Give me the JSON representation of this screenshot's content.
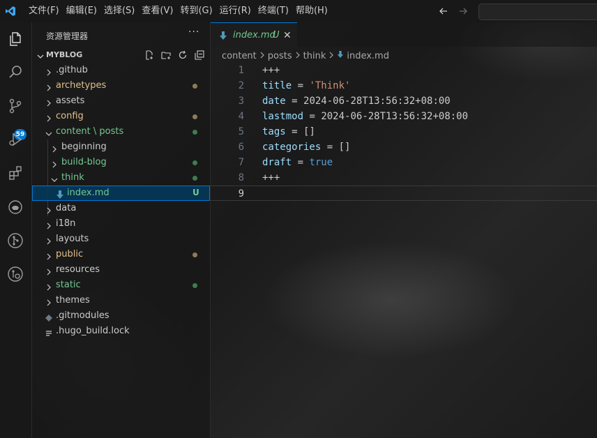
{
  "menu": [
    "文件(F)",
    "编辑(E)",
    "选择(S)",
    "查看(V)",
    "转到(G)",
    "运行(R)",
    "终端(T)",
    "帮助(H)"
  ],
  "activity": {
    "source_control_badge": "59"
  },
  "explorer": {
    "title": "资源管理器",
    "more": "···",
    "section": "MYBLOG",
    "items": [
      {
        "label": ".github",
        "color": "#cccccc"
      },
      {
        "label": "archetypes",
        "color": "#e2c08d",
        "dot": "#8f7b57"
      },
      {
        "label": "assets",
        "color": "#cccccc"
      },
      {
        "label": "config",
        "color": "#e2c08d",
        "dot": "#8f7b57"
      },
      {
        "label": "content \\ posts",
        "color": "#73c991",
        "dot": "#3f7d4d"
      },
      {
        "label": "beginning",
        "color": "#cccccc"
      },
      {
        "label": "build-blog",
        "color": "#73c991",
        "dot": "#3f7d4d"
      },
      {
        "label": "think",
        "color": "#73c991",
        "dot": "#3f7d4d"
      },
      {
        "label": "index.md",
        "color": "#73c991",
        "status": "U"
      },
      {
        "label": "data",
        "color": "#cccccc"
      },
      {
        "label": "i18n",
        "color": "#cccccc"
      },
      {
        "label": "layouts",
        "color": "#cccccc"
      },
      {
        "label": "public",
        "color": "#e2c08d",
        "dot": "#8f7b57"
      },
      {
        "label": "resources",
        "color": "#cccccc"
      },
      {
        "label": "static",
        "color": "#73c991",
        "dot": "#3f7d4d"
      },
      {
        "label": "themes",
        "color": "#cccccc"
      },
      {
        "label": ".gitmodules",
        "color": "#cccccc"
      },
      {
        "label": ".hugo_build.lock",
        "color": "#cccccc"
      }
    ]
  },
  "tab": {
    "name": "index.md",
    "status": "U",
    "close": "✕"
  },
  "breadcrumbs": [
    "content",
    "posts",
    "think",
    "index.md"
  ],
  "code_lines": [
    {
      "num": "1",
      "text": "+++"
    },
    {
      "num": "2",
      "key": "title",
      "eq": " = ",
      "value": "'Think'",
      "vtype": "str"
    },
    {
      "num": "3",
      "key": "date",
      "eq": " = ",
      "value": "2024-06-28T13:56:32+08:00",
      "vtype": "plain"
    },
    {
      "num": "4",
      "key": "lastmod",
      "eq": " = ",
      "value": "2024-06-28T13:56:32+08:00",
      "vtype": "plain"
    },
    {
      "num": "5",
      "key": "tags",
      "eq": " = ",
      "value": "[]",
      "vtype": "plain"
    },
    {
      "num": "6",
      "key": "categories",
      "eq": " = ",
      "value": "[]",
      "vtype": "plain"
    },
    {
      "num": "7",
      "key": "draft",
      "eq": " = ",
      "value": "true",
      "vtype": "bool"
    },
    {
      "num": "8",
      "text": "+++"
    },
    {
      "num": "9",
      "text": ""
    }
  ]
}
